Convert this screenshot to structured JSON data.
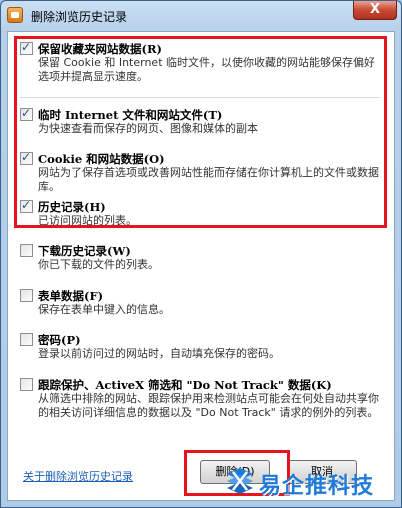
{
  "window": {
    "title": "删除浏览历史记录",
    "close_label": "X"
  },
  "options": [
    {
      "title": "保留收藏夹网站数据(R)",
      "desc": "保留 Cookie 和 Internet 临时文件，以使你收藏的网站能够保存偏好选项并提高显示速度。",
      "checked": true
    },
    {
      "title": "临时 Internet 文件和网站文件(T)",
      "desc": "为快速查看而保存的网页、图像和媒体的副本",
      "checked": true
    },
    {
      "title": "Cookie 和网站数据(O)",
      "desc": "网站为了保存首选项或改善网站性能而存储在你计算机上的文件或数据库。",
      "checked": true
    },
    {
      "title": "历史记录(H)",
      "desc": "已访问网站的列表。",
      "checked": true
    },
    {
      "title": "下载历史记录(W)",
      "desc": "你已下载的文件的列表。",
      "checked": false
    },
    {
      "title": "表单数据(F)",
      "desc": "保存在表单中键入的信息。",
      "checked": false
    },
    {
      "title": "密码(P)",
      "desc": "登录以前访问过的网站时，自动填充保存的密码。",
      "checked": false
    },
    {
      "title": "跟踪保护、ActiveX 筛选和 \"Do Not Track\" 数据(K)",
      "desc": "从筛选中排除的网站、跟踪保护用来检测站点可能会在何处自动共享你的相关访问详细信息的数据以及 \"Do Not Track\" 请求的例外的列表。",
      "checked": false
    }
  ],
  "footer": {
    "about_link": "关于删除浏览历史记录",
    "delete_button": "删除(D)",
    "cancel_button": "取消"
  },
  "watermark": {
    "brand": "易企推科技"
  },
  "colors": {
    "highlight_border": "#e8141c",
    "link": "#1a5fb4",
    "watermark": "#1f7ad8"
  }
}
